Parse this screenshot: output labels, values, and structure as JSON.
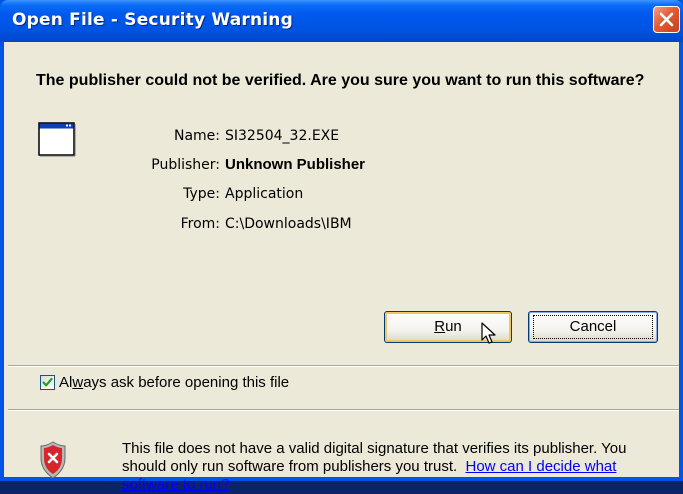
{
  "window": {
    "title": "Open File - Security Warning"
  },
  "dialog": {
    "question": "The publisher could not be verified.  Are you sure you want to run this software?",
    "fields": {
      "name_label": "Name:",
      "name_value": "SI32504_32.EXE",
      "publisher_label": "Publisher:",
      "publisher_value": "Unknown Publisher",
      "type_label": "Type:",
      "type_value": "Application",
      "from_label": "From:",
      "from_value": "C:\\Downloads\\IBM"
    },
    "buttons": {
      "run_first": "R",
      "run_rest": "un",
      "cancel": "Cancel"
    },
    "checkbox": {
      "label_pre": "Al",
      "label_accel": "w",
      "label_post": "ays ask before opening this file",
      "checked": true
    },
    "warning": {
      "text": "This file does not have a valid digital signature that verifies its publisher. You should only run software from publishers you trust.",
      "link_text": "How can I decide what software to run?"
    }
  },
  "icons": {
    "close": "close-icon",
    "app": "application-window-icon",
    "shield": "security-shield-icon",
    "check": "checkmark-icon",
    "cursor": "mouse-cursor-icon"
  },
  "colors": {
    "titlebar": "#0054e3",
    "dialog_bg": "#ece9d8",
    "close_button": "#e45a34",
    "link": "#0000ff"
  }
}
